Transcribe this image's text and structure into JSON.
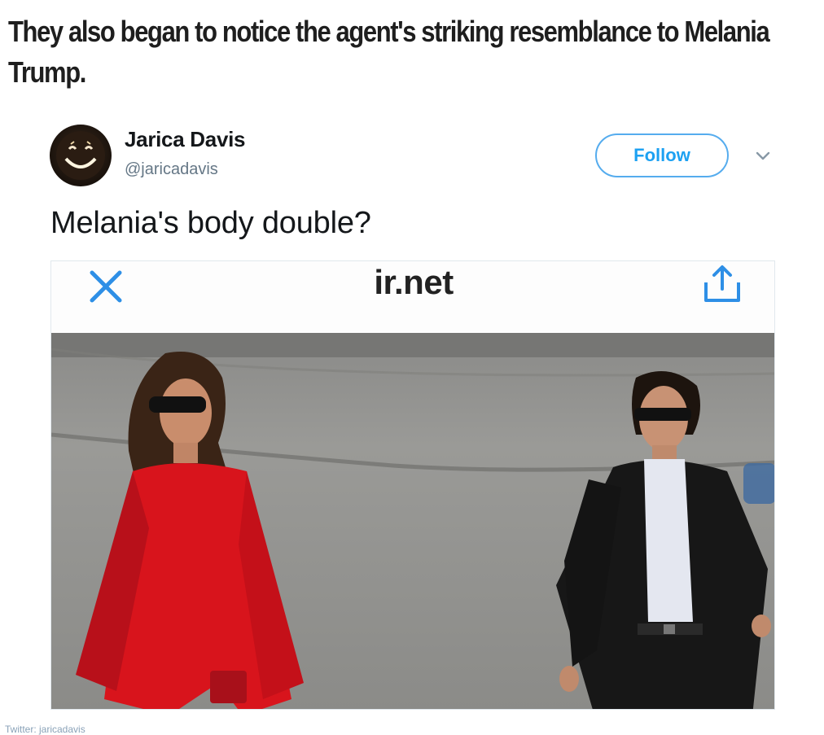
{
  "article": {
    "headline": "They also began to notice the agent's striking resemblance to Melania Trump."
  },
  "tweet": {
    "author_name": "Jarica Davis",
    "author_handle": "@jaricadavis",
    "follow_label": "Follow",
    "text": "Melania's body double?",
    "embed": {
      "url_text": "ir.net",
      "close_icon": "close-icon",
      "share_icon": "share-icon"
    }
  },
  "credit": {
    "text": "Twitter: jaricadavis"
  },
  "colors": {
    "twitter_blue": "#1da1f2",
    "handle_gray": "#657786",
    "dress_red": "#d8141c"
  }
}
